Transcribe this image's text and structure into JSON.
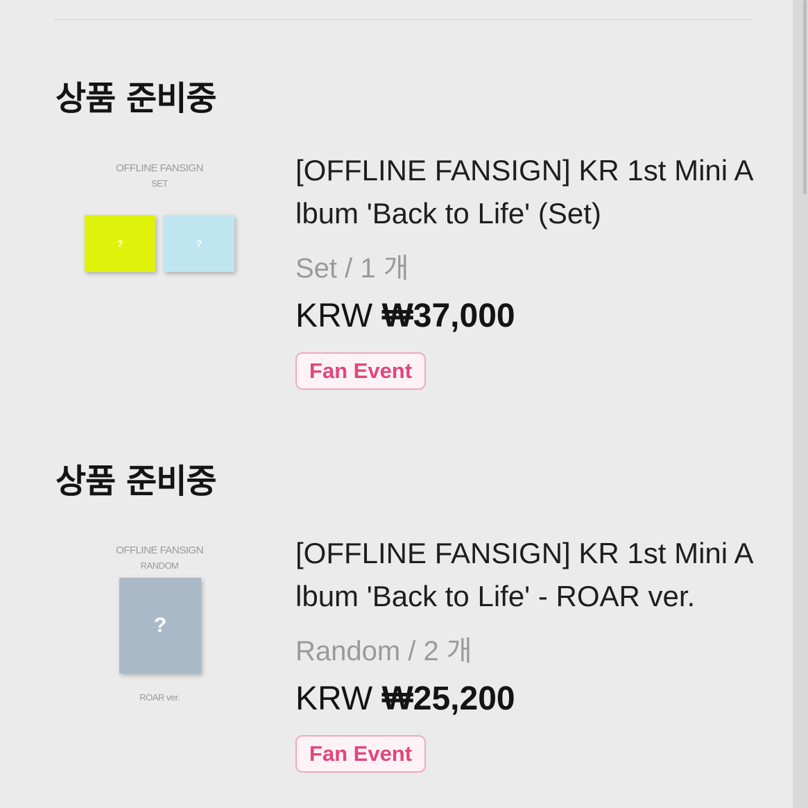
{
  "items": [
    {
      "status": "상품 준비중",
      "thumbnail": {
        "caption_top": "OFFLINE FANSIGN",
        "caption_sub": "SET",
        "caption_bottom": "",
        "boxes": [
          {
            "label": "?",
            "color": "#dff20a"
          },
          {
            "label": "?",
            "color": "#bfe6f0"
          }
        ]
      },
      "title": "[OFFLINE FANSIGN] KR 1st Mini Album 'Back to Life' (Set)",
      "option": "Set / 1 개",
      "currency": "KRW",
      "price": "₩37,000",
      "badge": "Fan Event"
    },
    {
      "status": "상품 준비중",
      "thumbnail": {
        "caption_top": "OFFLINE FANSIGN",
        "caption_sub": "RANDOM",
        "caption_bottom": "ROAR ver.",
        "boxes": [
          {
            "label": "?",
            "color": "#a9b9c8"
          }
        ]
      },
      "title": "[OFFLINE FANSIGN] KR 1st Mini Album 'Back to Life' - ROAR ver.",
      "option": "Random / 2 개",
      "currency": "KRW",
      "price": "₩25,200",
      "badge": "Fan Event"
    }
  ],
  "colors": {
    "background": "#ebebeb",
    "badge_text": "#e2457c",
    "badge_border": "#f0a8c0",
    "muted_text": "#9a9a9a"
  }
}
